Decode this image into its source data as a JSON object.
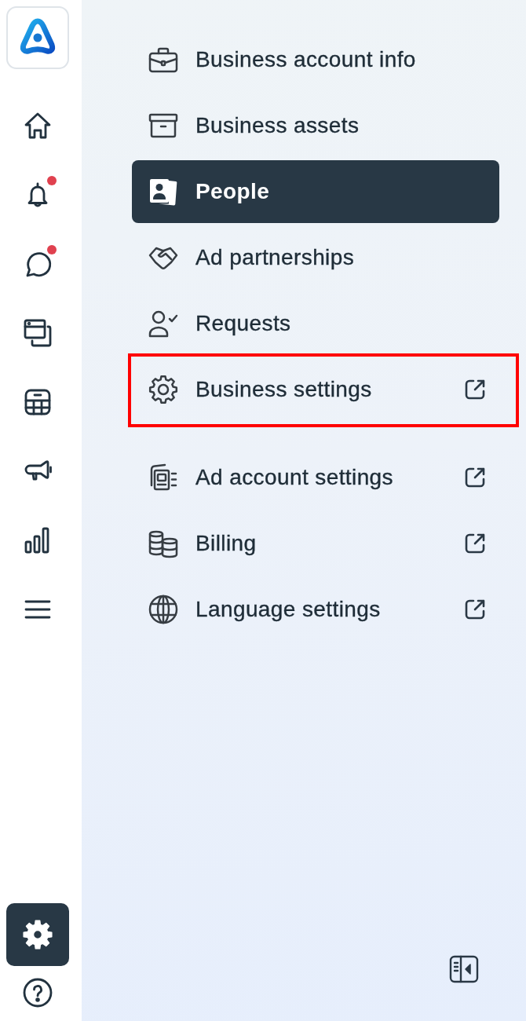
{
  "rail": {
    "items": [
      {
        "selected": false,
        "badge": false
      },
      {
        "selected": false,
        "badge": true
      },
      {
        "selected": false,
        "badge": true
      },
      {
        "selected": false,
        "badge": false
      },
      {
        "selected": false,
        "badge": false
      },
      {
        "selected": false,
        "badge": false
      },
      {
        "selected": false,
        "badge": false
      },
      {
        "selected": false,
        "badge": false
      }
    ],
    "bottom_items": [
      {
        "selected": true
      },
      {
        "selected": false
      }
    ]
  },
  "menu": {
    "sections": [
      {
        "items": [
          {
            "label": "Business account info",
            "selected": false,
            "external": false,
            "highlighted": false
          },
          {
            "label": "Business assets",
            "selected": false,
            "external": false,
            "highlighted": false
          },
          {
            "label": "People",
            "selected": true,
            "external": false,
            "highlighted": false
          },
          {
            "label": "Ad partnerships",
            "selected": false,
            "external": false,
            "highlighted": false
          },
          {
            "label": "Requests",
            "selected": false,
            "external": false,
            "highlighted": false
          },
          {
            "label": "Business settings",
            "selected": false,
            "external": true,
            "highlighted": true
          }
        ]
      },
      {
        "items": [
          {
            "label": "Ad account settings",
            "selected": false,
            "external": true,
            "highlighted": false
          },
          {
            "label": "Billing",
            "selected": false,
            "external": true,
            "highlighted": false
          },
          {
            "label": "Language settings",
            "selected": false,
            "external": true,
            "highlighted": false
          }
        ]
      }
    ]
  }
}
